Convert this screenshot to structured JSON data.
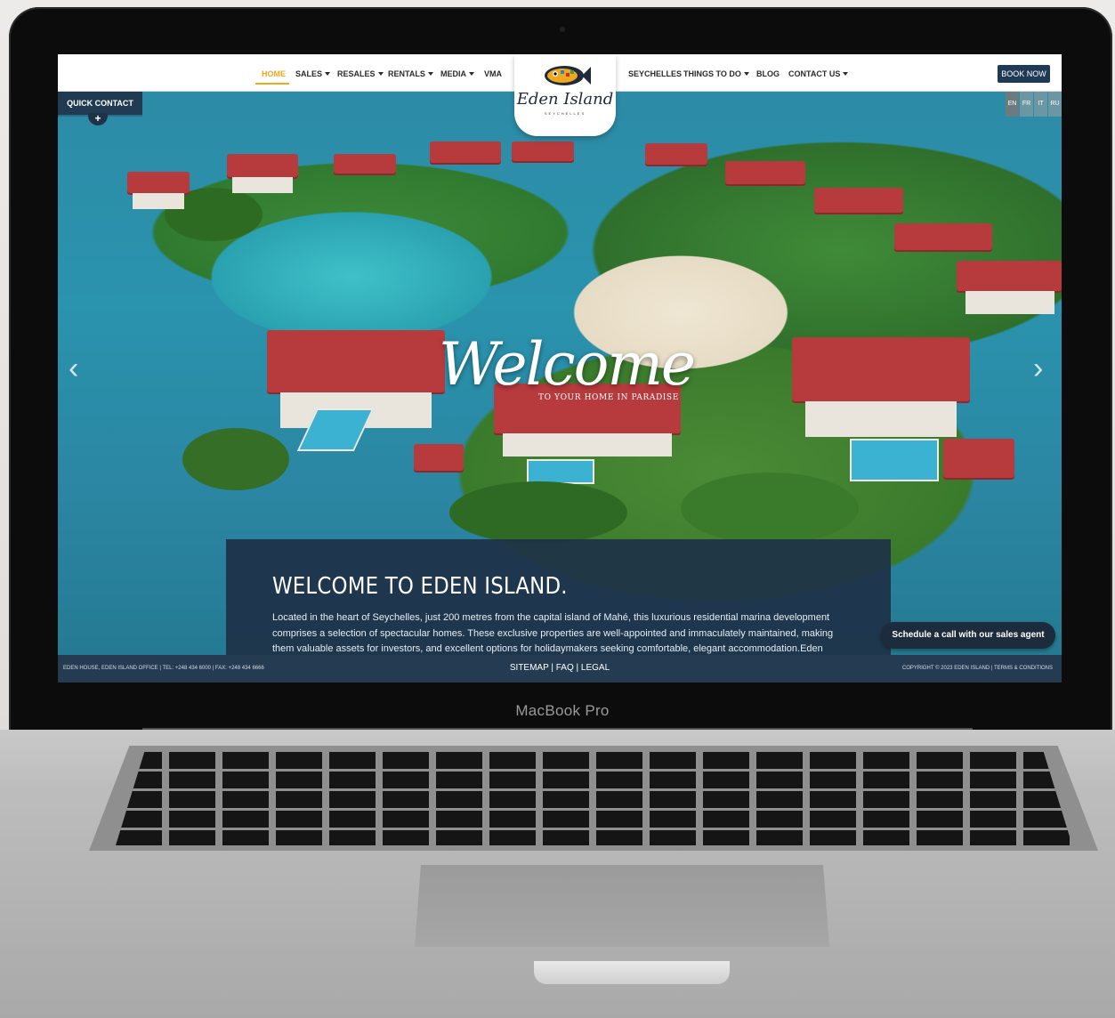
{
  "device": {
    "brand_label": "MacBook Pro"
  },
  "nav": {
    "left_items": [
      {
        "label": "HOME",
        "active": true,
        "dropdown": false
      },
      {
        "label": "SALES",
        "dropdown": true
      },
      {
        "label": "RESALES",
        "dropdown": true
      },
      {
        "label": "RENTALS",
        "dropdown": true
      },
      {
        "label": "MEDIA",
        "dropdown": true
      },
      {
        "label": "VMA",
        "dropdown": false
      }
    ],
    "right_items": [
      {
        "label": "SEYCHELLES",
        "dropdown": false
      },
      {
        "label": "THINGS TO DO",
        "dropdown": true
      },
      {
        "label": "BLOG",
        "dropdown": false
      },
      {
        "label": "CONTACT US",
        "dropdown": true
      }
    ],
    "book_now": "BOOK NOW",
    "active_color": "#f0a81e"
  },
  "logo": {
    "text": "Eden Island",
    "subtext": "SEYCHELLES"
  },
  "quick_contact": {
    "label": "QUICK CONTACT",
    "plus": "+"
  },
  "languages": [
    {
      "code": "EN",
      "active": true
    },
    {
      "code": "FR",
      "active": false
    },
    {
      "code": "IT",
      "active": false
    },
    {
      "code": "RU",
      "active": false
    }
  ],
  "hero": {
    "script_title": "Welcome",
    "subtitle": "TO YOUR HOME IN PARADISE",
    "prev_icon": "chevron-left-icon",
    "next_icon": "chevron-right-icon"
  },
  "intro": {
    "title": "WELCOME TO EDEN ISLAND.",
    "text": "Located in the heart of Seychelles, just 200 metres from the capital island of Mahé, this luxurious residential marina development comprises a selection of spectacular homes. These exclusive properties are well-appointed and immaculately maintained, making them valuable assets for investors, and excellent options for holidaymakers seeking comfortable, elegant accommodation.Eden"
  },
  "cta": {
    "label": "Schedule a call with our sales agent"
  },
  "footer": {
    "address": "EDEN HOUSE, EDEN ISLAND OFFICE | TEL: +248 434 6000 | FAX: +248 434 6666",
    "links": "SITEMAP | FAQ | LEGAL",
    "copyright": "COPYRIGHT © 2023 EDEN ISLAND | TERMS & CONDITIONS"
  },
  "colors": {
    "navy": "#1f3a56",
    "accent": "#f0a81e",
    "roof": "#b73a3d"
  }
}
